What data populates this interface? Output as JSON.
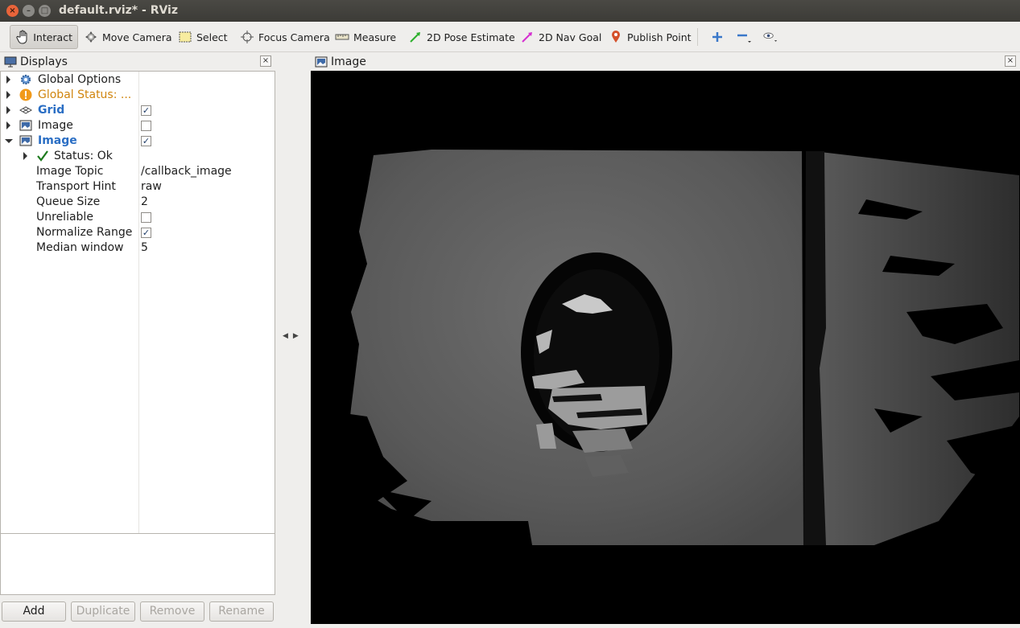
{
  "window": {
    "title": "default.rviz* - RViz",
    "close_glyph": "×",
    "min_glyph": "–",
    "max_glyph": "□"
  },
  "toolbar": {
    "interact": "Interact",
    "move_camera": "Move Camera",
    "select": "Select",
    "focus_camera": "Focus Camera",
    "measure": "Measure",
    "pose_estimate": "2D Pose Estimate",
    "nav_goal": "2D Nav Goal",
    "publish_point": "Publish Point",
    "icons": [
      "hand-icon",
      "move-camera-icon",
      "select-icon",
      "focus-camera-icon",
      "measure-icon",
      "pose-estimate-arrow-icon",
      "nav-goal-arrow-icon",
      "publish-point-pin-icon",
      "plus-icon",
      "minus-icon",
      "eye-icon"
    ]
  },
  "displays": {
    "title": "Displays",
    "close_glyph": "×",
    "rows": [
      {
        "label": "Global Options",
        "icon": "gear-icon"
      },
      {
        "label": "Global Status: ...",
        "icon": "warning-icon"
      },
      {
        "label": "Grid",
        "icon": "grid-icon",
        "checked": true
      },
      {
        "label": "Image",
        "icon": "image-icon",
        "checked": false
      },
      {
        "label": "Image",
        "icon": "image-icon",
        "checked": true
      }
    ],
    "status": "Status: Ok",
    "properties": [
      {
        "label": "Image Topic",
        "value": "/callback_image"
      },
      {
        "label": "Transport Hint",
        "value": "raw"
      },
      {
        "label": "Queue Size",
        "value": "2"
      },
      {
        "label": "Unreliable",
        "checked": false
      },
      {
        "label": "Normalize Range",
        "checked": true
      },
      {
        "label": "Median window",
        "value": "5"
      }
    ],
    "check_glyph": "✓",
    "buttons": {
      "add": "Add",
      "duplicate": "Duplicate",
      "remove": "Remove",
      "rename": "Rename"
    }
  },
  "image_panel": {
    "title": "Image",
    "close_glyph": "×"
  },
  "colors": {
    "accent_blue": "#2a6ec4",
    "warning": "#d0850e",
    "titlebar": "#3c3b37",
    "close_button": "#e9643a"
  }
}
